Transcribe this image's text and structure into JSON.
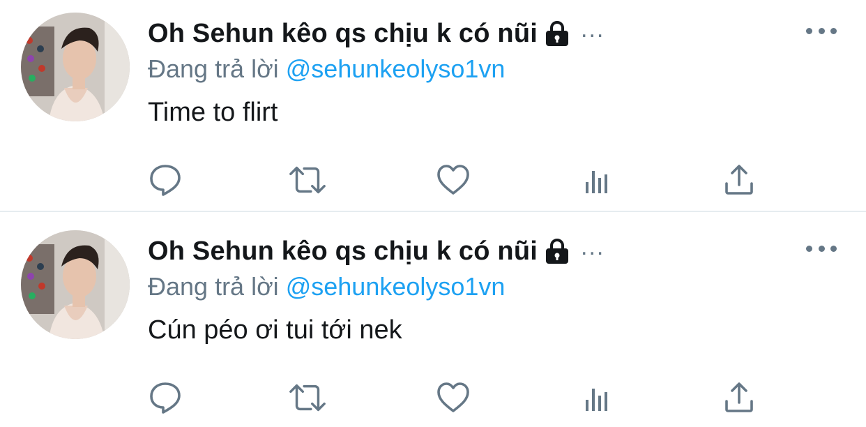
{
  "colors": {
    "text_primary": "#14171a",
    "text_secondary": "#657786",
    "link_blue": "#1da1f2",
    "divider": "#e6ecf0"
  },
  "tweets": [
    {
      "author_name": "Oh Sehun kêo qs chịu k có nũi",
      "author_badge_icon": "lock-icon",
      "name_truncation": "...",
      "reply_prefix": "Đang trả lời",
      "reply_handle": "@sehunkeolyso1vn",
      "text": "Time to flirt",
      "actions": [
        "reply-icon",
        "retweet-icon",
        "like-icon",
        "analytics-icon",
        "share-icon"
      ]
    },
    {
      "author_name": "Oh Sehun kêo qs chịu k có nũi",
      "author_badge_icon": "lock-icon",
      "name_truncation": "...",
      "reply_prefix": "Đang trả lời",
      "reply_handle": "@sehunkeolyso1vn",
      "text": "Cún péo ơi tui tới nek",
      "actions": [
        "reply-icon",
        "retweet-icon",
        "like-icon",
        "analytics-icon",
        "share-icon"
      ]
    }
  ]
}
